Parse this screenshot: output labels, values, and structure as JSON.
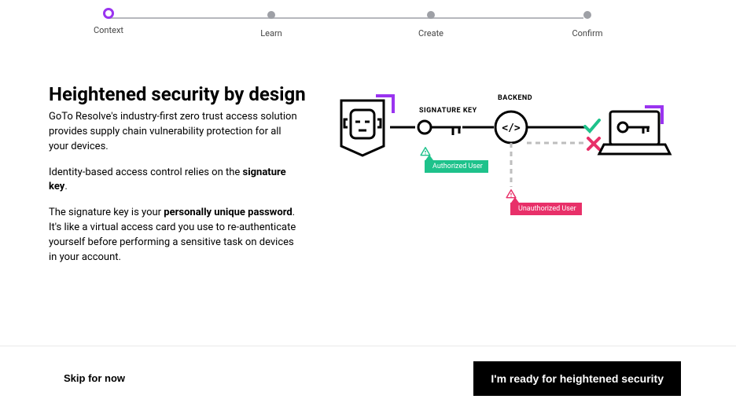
{
  "stepper": {
    "steps": [
      "Context",
      "Learn",
      "Create",
      "Confirm"
    ],
    "activeIndex": 0
  },
  "heading": "Heightened security by design",
  "paragraphs": {
    "p1": "GoTo Resolve's industry-first zero trust access solution provides supply chain vulnerability protection for all your devices.",
    "p2a": "Identity-based access control relies on the ",
    "p2b": "signature key",
    "p2c": ".",
    "p3a": "The signature key is your ",
    "p3b": "personally unique password",
    "p3c": ". It's like a virtual access card you use to re-authenticate yourself before performing a sensitive task on devices in your account."
  },
  "diagram": {
    "sigKeyLabel": "SIGNATURE KEY",
    "backendLabel": "BACKEND",
    "authorized": "Authorized User",
    "unauthorized": "Unauthorized User"
  },
  "footer": {
    "skip": "Skip for now",
    "primary": "I'm ready for heightened security"
  },
  "colors": {
    "accentPurple": "#9A34F0",
    "green": "#1EC28B",
    "pink": "#E83069"
  }
}
